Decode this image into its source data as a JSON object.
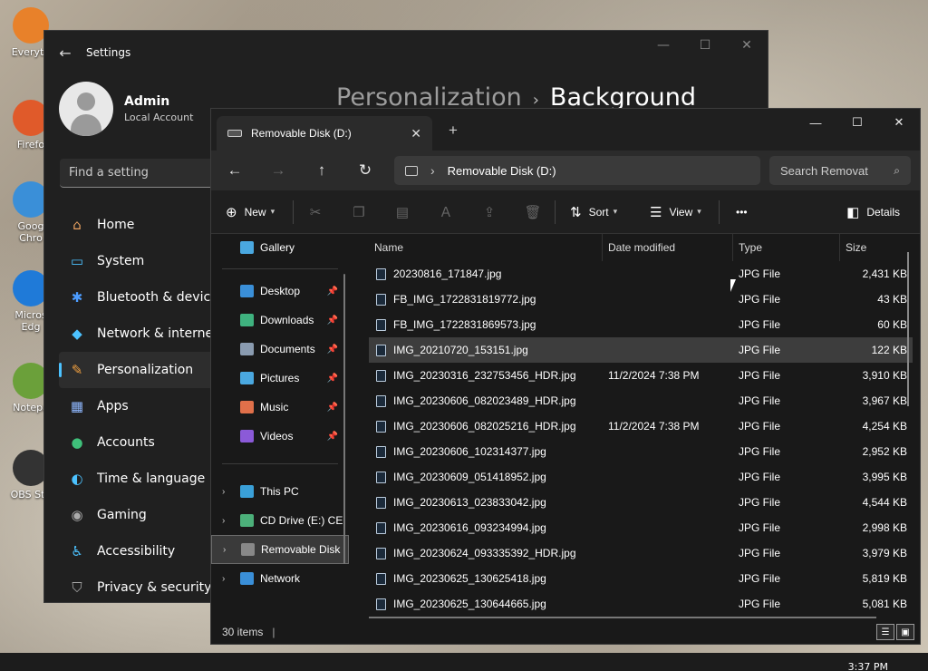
{
  "desktop": {
    "icons": [
      "Everyth",
      "Firefo",
      "Goog Chro",
      "Micros Edg",
      "Notepa",
      "OBS Stu"
    ]
  },
  "settings": {
    "window_title": "Settings",
    "user_name": "Admin",
    "account_type": "Local Account",
    "search_placeholder": "Find a setting",
    "breadcrumb_parent": "Personalization",
    "breadcrumb_current": "Background",
    "nav": [
      {
        "label": "Home",
        "icon": "home-icon"
      },
      {
        "label": "System",
        "icon": "system-icon"
      },
      {
        "label": "Bluetooth & devices",
        "icon": "bluetooth-icon"
      },
      {
        "label": "Network & internet",
        "icon": "wifi-icon"
      },
      {
        "label": "Personalization",
        "icon": "brush-icon"
      },
      {
        "label": "Apps",
        "icon": "apps-icon"
      },
      {
        "label": "Accounts",
        "icon": "accounts-icon"
      },
      {
        "label": "Time & language",
        "icon": "globe-icon"
      },
      {
        "label": "Gaming",
        "icon": "gamepad-icon"
      },
      {
        "label": "Accessibility",
        "icon": "accessibility-icon"
      },
      {
        "label": "Privacy & security",
        "icon": "shield-icon"
      }
    ],
    "accent": "#4cc2ff"
  },
  "explorer": {
    "tab_title": "Removable Disk (D:)",
    "address": "Removable Disk (D:)",
    "search_placeholder": "Search Removat",
    "commands": {
      "new": "New",
      "sort": "Sort",
      "view": "View",
      "more": "•••",
      "details": "Details"
    },
    "sidebar": {
      "gallery": "Gallery",
      "quick": [
        {
          "label": "Desktop",
          "color": "#3a8fd8"
        },
        {
          "label": "Downloads",
          "color": "#3fb27f"
        },
        {
          "label": "Documents",
          "color": "#8a9bb0"
        },
        {
          "label": "Pictures",
          "color": "#4aa8e0"
        },
        {
          "label": "Music",
          "color": "#e0704a"
        },
        {
          "label": "Videos",
          "color": "#8b5ad8"
        }
      ],
      "drives": [
        {
          "label": "This PC",
          "color": "#3aa0d8"
        },
        {
          "label": "CD Drive (E:) CE",
          "color": "#4cb07a"
        },
        {
          "label": "Removable Disk",
          "color": "#888888"
        },
        {
          "label": "Network",
          "color": "#3a8fd8"
        }
      ]
    },
    "columns": {
      "name": "Name",
      "date": "Date modified",
      "type": "Type",
      "size": "Size"
    },
    "files": [
      {
        "name": "20230816_171847.jpg",
        "date": "",
        "type": "JPG File",
        "size": "2,431 KB"
      },
      {
        "name": "FB_IMG_1722831819772.jpg",
        "date": "",
        "type": "JPG File",
        "size": "43 KB"
      },
      {
        "name": "FB_IMG_1722831869573.jpg",
        "date": "",
        "type": "JPG File",
        "size": "60 KB"
      },
      {
        "name": "IMG_20210720_153151.jpg",
        "date": "",
        "type": "JPG File",
        "size": "122 KB"
      },
      {
        "name": "IMG_20230316_232753456_HDR.jpg",
        "date": "11/2/2024 7:38 PM",
        "type": "JPG File",
        "size": "3,910 KB"
      },
      {
        "name": "IMG_20230606_082023489_HDR.jpg",
        "date": "",
        "type": "JPG File",
        "size": "3,967 KB"
      },
      {
        "name": "IMG_20230606_082025216_HDR.jpg",
        "date": "11/2/2024 7:38 PM",
        "type": "JPG File",
        "size": "4,254 KB"
      },
      {
        "name": "IMG_20230606_102314377.jpg",
        "date": "",
        "type": "JPG File",
        "size": "2,952 KB"
      },
      {
        "name": "IMG_20230609_051418952.jpg",
        "date": "",
        "type": "JPG File",
        "size": "3,995 KB"
      },
      {
        "name": "IMG_20230613_023833042.jpg",
        "date": "",
        "type": "JPG File",
        "size": "4,544 KB"
      },
      {
        "name": "IMG_20230616_093234994.jpg",
        "date": "",
        "type": "JPG File",
        "size": "2,998 KB"
      },
      {
        "name": "IMG_20230624_093335392_HDR.jpg",
        "date": "",
        "type": "JPG File",
        "size": "3,979 KB"
      },
      {
        "name": "IMG_20230625_130625418.jpg",
        "date": "",
        "type": "JPG File",
        "size": "5,819 KB"
      },
      {
        "name": "IMG_20230625_130644665.jpg",
        "date": "",
        "type": "JPG File",
        "size": "5,081 KB"
      }
    ],
    "selected_file": "IMG_20210720_153151.jpg",
    "status": "30 items"
  },
  "taskbar": {
    "clock": "3:37 PM"
  }
}
